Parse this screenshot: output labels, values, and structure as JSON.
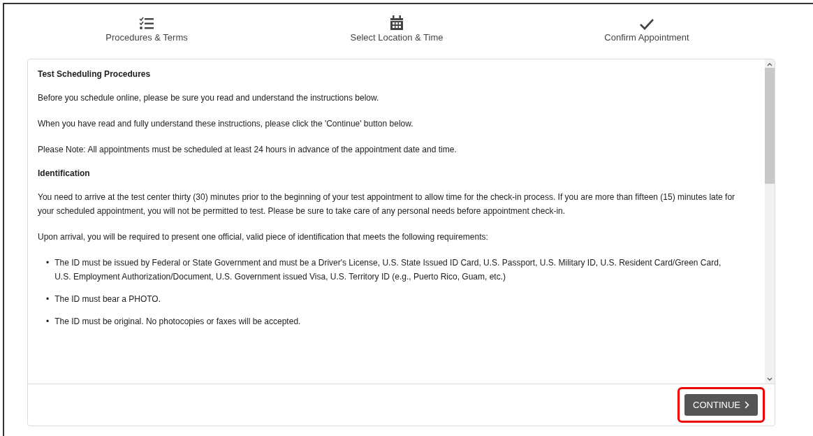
{
  "steps": [
    {
      "label": "Procedures & Terms"
    },
    {
      "label": "Select Location & Time"
    },
    {
      "label": "Confirm Appointment"
    }
  ],
  "content": [
    {
      "kind": "heading",
      "text": "Test Scheduling Procedures"
    },
    {
      "kind": "paragraph",
      "text": "Before you schedule online, please be sure you read and understand the instructions below."
    },
    {
      "kind": "paragraph",
      "text": "When you have read and fully understand these instructions, please click the 'Continue' button below."
    },
    {
      "kind": "paragraph",
      "text": "Please Note: All appointments must be scheduled at least 24 hours in advance of the appointment date and time."
    },
    {
      "kind": "heading",
      "text": "Identification"
    },
    {
      "kind": "paragraph",
      "text": "You need to arrive at the test center thirty (30) minutes prior to the beginning of your test appointment to allow time for the check-in process. If you are more than fifteen (15) minutes late for your scheduled appointment, you will not be permitted to test. Please be sure to take care of any personal needs before appointment check-in."
    },
    {
      "kind": "paragraph",
      "text": "Upon arrival, you will be required to present one official, valid piece of identification that meets the following requirements:"
    },
    {
      "kind": "list",
      "bullet": "•",
      "items": [
        "The ID must be issued by Federal or State Government and must be a Driver's License, U.S. State Issued ID Card, U.S. Passport, U.S. Military ID, U.S. Resident Card/Green Card, U.S. Employment Authorization/Document, U.S. Government issued Visa, U.S. Territory ID (e.g., Puerto Rico, Guam, etc.)",
        "The ID must bear a PHOTO.",
        "The ID must be original. No photocopies or faxes will be accepted."
      ]
    }
  ],
  "continue_button": {
    "label": "CONTINUE",
    "highlighted": true
  }
}
